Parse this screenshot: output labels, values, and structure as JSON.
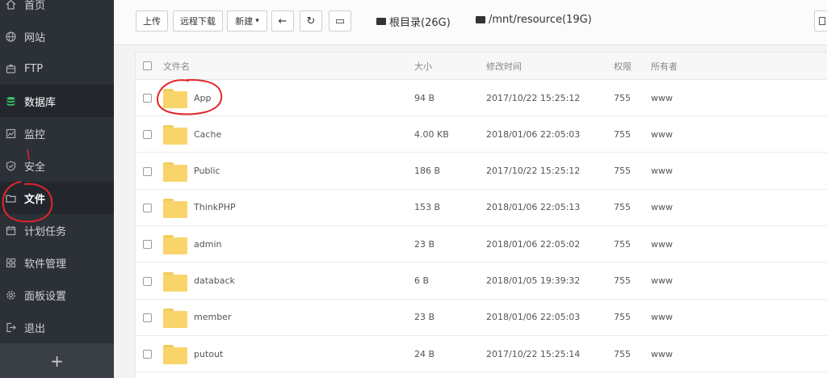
{
  "sidebar": {
    "items": [
      {
        "label": "首页",
        "icon": "home-icon"
      },
      {
        "label": "网站",
        "icon": "globe-icon"
      },
      {
        "label": "FTP",
        "icon": "ftp-icon"
      },
      {
        "label": "数据库",
        "icon": "database-icon"
      },
      {
        "label": "监控",
        "icon": "monitor-icon"
      },
      {
        "label": "安全",
        "icon": "shield-icon"
      },
      {
        "label": "文件",
        "icon": "folder-icon"
      },
      {
        "label": "计划任务",
        "icon": "calendar-icon"
      },
      {
        "label": "软件管理",
        "icon": "apps-icon"
      },
      {
        "label": "面板设置",
        "icon": "gear-icon"
      },
      {
        "label": "退出",
        "icon": "logout-icon"
      }
    ],
    "add_label": "+",
    "active": "文件"
  },
  "toolbar": {
    "upload": "上传",
    "remote_download": "远程下载",
    "new": "新建",
    "new_caret": "▾",
    "back": "←",
    "refresh": "↻",
    "terminal": "▭",
    "disks": [
      {
        "label": "根目录(26G)"
      },
      {
        "label": "/mnt/resource(19G)"
      }
    ]
  },
  "table": {
    "headers": {
      "name": "文件名",
      "size": "大小",
      "mtime": "修改时间",
      "perm": "权限",
      "owner": "所有者"
    },
    "rows": [
      {
        "name": "App",
        "size": "94 B",
        "mtime": "2017/10/22 15:25:12",
        "perm": "755",
        "owner": "www"
      },
      {
        "name": "Cache",
        "size": "4.00 KB",
        "mtime": "2018/01/06 22:05:03",
        "perm": "755",
        "owner": "www"
      },
      {
        "name": "Public",
        "size": "186 B",
        "mtime": "2017/10/22 15:25:12",
        "perm": "755",
        "owner": "www"
      },
      {
        "name": "ThinkPHP",
        "size": "153 B",
        "mtime": "2018/01/06 22:05:13",
        "perm": "755",
        "owner": "www"
      },
      {
        "name": "admin",
        "size": "23 B",
        "mtime": "2018/01/06 22:05:02",
        "perm": "755",
        "owner": "www"
      },
      {
        "name": "databack",
        "size": "6 B",
        "mtime": "2018/01/05 19:39:32",
        "perm": "755",
        "owner": "www"
      },
      {
        "name": "member",
        "size": "23 B",
        "mtime": "2018/01/06 22:05:03",
        "perm": "755",
        "owner": "www"
      },
      {
        "name": "putout",
        "size": "24 B",
        "mtime": "2017/10/22 15:25:14",
        "perm": "755",
        "owner": "www"
      }
    ]
  },
  "colors": {
    "sidebar_bg": "#2c3138",
    "sidebar_active_bg": "#23272d",
    "annotation_red": "#e0262b",
    "folder_yellow": "#f8d46b"
  }
}
